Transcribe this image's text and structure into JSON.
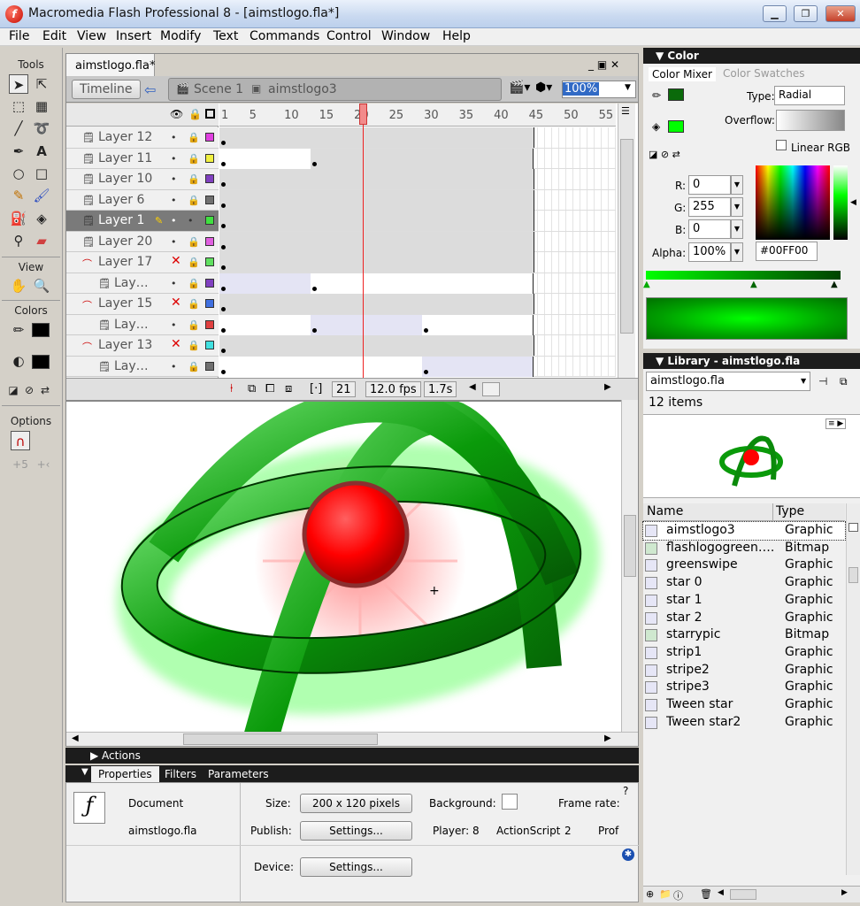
{
  "window": {
    "title": "Macromedia Flash Professional 8 - [aimstlogo.fla*]",
    "app_icon_letter": "f"
  },
  "menu": [
    "File",
    "Edit",
    "View",
    "Insert",
    "Modify",
    "Text",
    "Commands",
    "Control",
    "Window",
    "Help"
  ],
  "tools": {
    "title": "Tools",
    "view_title": "View",
    "colors_title": "Colors",
    "options_title": "Options"
  },
  "document": {
    "tab": "aimstlogo.fla*",
    "timeline_button": "Timeline",
    "scene": "Scene 1",
    "symbol": "aimstlogo3",
    "zoom": "100%"
  },
  "timeline": {
    "ruler_ticks": [
      "1",
      "5",
      "10",
      "15",
      "20",
      "25",
      "30",
      "35",
      "40",
      "45",
      "50",
      "55"
    ],
    "layers": [
      {
        "name": "Layer 12",
        "type": "normal",
        "color": "#e040e0"
      },
      {
        "name": "Layer 11",
        "type": "normal",
        "color": "#f0f040"
      },
      {
        "name": "Layer 10",
        "type": "normal",
        "color": "#8040c0"
      },
      {
        "name": "Layer 6",
        "type": "normal",
        "color": "#707070"
      },
      {
        "name": "Layer 1",
        "type": "normal",
        "color": "#40e040",
        "selected": true
      },
      {
        "name": "Layer 20",
        "type": "normal",
        "color": "#e060e0"
      },
      {
        "name": "Layer 17",
        "type": "guide",
        "color": "#60e060"
      },
      {
        "name": "Lay…",
        "type": "guided",
        "color": "#8040c0"
      },
      {
        "name": "Layer 15",
        "type": "guide",
        "color": "#4070e0"
      },
      {
        "name": "Lay…",
        "type": "guided",
        "color": "#e04040"
      },
      {
        "name": "Layer 13",
        "type": "guide",
        "color": "#40e0e0"
      },
      {
        "name": "Lay…",
        "type": "guided",
        "color": "#707070"
      }
    ],
    "current_frame": "21",
    "fps": "12.0 fps",
    "elapsed": "1.7s"
  },
  "properties": {
    "actions_title": "Actions",
    "tabs": [
      "Properties",
      "Filters",
      "Parameters"
    ],
    "doc_label": "Document",
    "doc_name": "aimstlogo.fla",
    "size_label": "Size:",
    "size_value": "200 x 120 pixels",
    "background_label": "Background:",
    "frame_rate_label": "Frame rate:",
    "publish_label": "Publish:",
    "settings_button": "Settings...",
    "player": "Player: 8",
    "actionscript_label": "ActionScript",
    "actionscript_value": "2",
    "profile": "Prof",
    "device_label": "Device:",
    "device_button": "Settings..."
  },
  "color": {
    "title": "Color",
    "tab_mixer": "Color Mixer",
    "tab_swatches": "Color Swatches",
    "type_label": "Type:",
    "type_value": "Radial",
    "overflow_label": "Overflow:",
    "linear_rgb": "Linear RGB",
    "r_label": "R:",
    "r_value": "0",
    "g_label": "G:",
    "g_value": "255",
    "b_label": "B:",
    "b_value": "0",
    "alpha_label": "Alpha:",
    "alpha_value": "100%",
    "hex": "#00FF00",
    "accent": "#00ff00"
  },
  "library": {
    "title": "Library - aimstlogo.fla",
    "doc_select": "aimstlogo.fla",
    "count": "12 items",
    "col_name": "Name",
    "col_type": "Type",
    "items": [
      {
        "name": "aimstlogo3",
        "type": "Graphic",
        "kind": "graphic",
        "selected": true
      },
      {
        "name": "flashlogogreen….",
        "type": "Bitmap",
        "kind": "bitmap"
      },
      {
        "name": "greenswipe",
        "type": "Graphic",
        "kind": "graphic"
      },
      {
        "name": "star 0",
        "type": "Graphic",
        "kind": "graphic"
      },
      {
        "name": "star 1",
        "type": "Graphic",
        "kind": "graphic"
      },
      {
        "name": "star 2",
        "type": "Graphic",
        "kind": "graphic"
      },
      {
        "name": "starrypic",
        "type": "Bitmap",
        "kind": "bitmap"
      },
      {
        "name": "strip1",
        "type": "Graphic",
        "kind": "graphic"
      },
      {
        "name": "stripe2",
        "type": "Graphic",
        "kind": "graphic"
      },
      {
        "name": "stripe3",
        "type": "Graphic",
        "kind": "graphic"
      },
      {
        "name": "Tween star",
        "type": "Graphic",
        "kind": "graphic"
      },
      {
        "name": "Tween star2",
        "type": "Graphic",
        "kind": "graphic"
      }
    ]
  }
}
